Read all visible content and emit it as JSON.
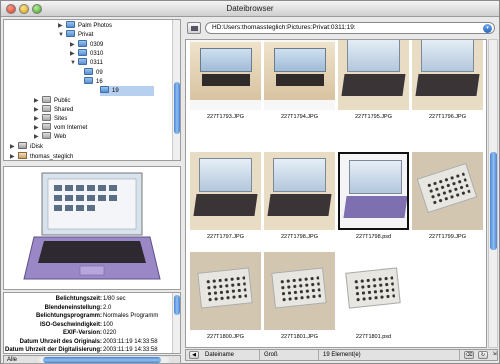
{
  "window": {
    "title": "Dateibrowser"
  },
  "tree": {
    "items": [
      {
        "label": "Palm Photos",
        "depth": 3,
        "expanded": false,
        "icon": "folder-icon",
        "selected": false
      },
      {
        "label": "Privat",
        "depth": 3,
        "expanded": true,
        "icon": "folder-icon",
        "selected": false
      },
      {
        "label": "0309",
        "depth": 4,
        "expanded": false,
        "icon": "folder-icon",
        "selected": false
      },
      {
        "label": "0310",
        "depth": 4,
        "expanded": false,
        "icon": "folder-icon",
        "selected": false
      },
      {
        "label": "0311",
        "depth": 4,
        "expanded": true,
        "icon": "folder-icon",
        "selected": false
      },
      {
        "label": "09",
        "depth": 5,
        "expanded": false,
        "icon": "folder-icon",
        "selected": false
      },
      {
        "label": "16",
        "depth": 5,
        "expanded": false,
        "icon": "folder-icon",
        "selected": false
      },
      {
        "label": "19",
        "depth": 5,
        "expanded": false,
        "icon": "folder-icon",
        "selected": true
      },
      {
        "label": "Public",
        "depth": 2,
        "expanded": false,
        "icon": "folder-icon",
        "selected": false
      },
      {
        "label": "Shared",
        "depth": 2,
        "expanded": false,
        "icon": "folder-icon",
        "selected": false
      },
      {
        "label": "Sites",
        "depth": 2,
        "expanded": false,
        "icon": "folder-icon",
        "selected": false
      },
      {
        "label": "vom Internet",
        "depth": 2,
        "expanded": false,
        "icon": "folder-icon",
        "selected": false
      },
      {
        "label": "Web",
        "depth": 2,
        "expanded": false,
        "icon": "folder-icon",
        "selected": false
      },
      {
        "label": "iDisk",
        "depth": 0,
        "expanded": false,
        "icon": "disk-icon",
        "selected": false
      },
      {
        "label": "thomas_steglich",
        "depth": 0,
        "expanded": false,
        "icon": "home-icon",
        "selected": false
      }
    ]
  },
  "info": {
    "rows": [
      {
        "key": "Belichtungszeit:",
        "value": "1/80 sec"
      },
      {
        "key": "Blendeneinstellung:",
        "value": "2.0"
      },
      {
        "key": "Belichtungsprogramm:",
        "value": "Normales Programm"
      },
      {
        "key": "ISO-Geschwindigkeit:",
        "value": "100"
      },
      {
        "key": "EXIF-Version:",
        "value": "0220"
      },
      {
        "key": "Datum Uhrzeit des Originals:",
        "value": "2003:11:19 14:33:58"
      },
      {
        "key": "Datum Uhrzeit der Digitalisierung:",
        "value": "2003:11:19 14:33:58"
      }
    ]
  },
  "left_bottom": {
    "label": "Alle"
  },
  "path": {
    "value": "HD:Users:thomassteglich:Pictures:Privat:0311:19:"
  },
  "files": [
    {
      "name": "227T1793.JPG",
      "kind": "desk"
    },
    {
      "name": "227T1794.JPG",
      "kind": "desk"
    },
    {
      "name": "227T1795.JPG",
      "kind": "laptop"
    },
    {
      "name": "227T1796.JPG",
      "kind": "laptop"
    },
    {
      "name": "227T1797.JPG",
      "kind": "laptop"
    },
    {
      "name": "227T1798.JPG",
      "kind": "laptop"
    },
    {
      "name": "227T1798.psd",
      "kind": "laptop-purple",
      "selected": true
    },
    {
      "name": "227T1799.JPG",
      "kind": "slides-tilt"
    },
    {
      "name": "227T1800.JPG",
      "kind": "slides"
    },
    {
      "name": "227T1801.JPG",
      "kind": "slides"
    },
    {
      "name": "227T1801.psd",
      "kind": "slides-white"
    }
  ],
  "status": {
    "sort": "Dateiname",
    "size": "Groß",
    "count": "19 Element(e)"
  },
  "colors": {
    "selection": "#b8d0f0",
    "scroll_accent": "#4a86d2"
  }
}
